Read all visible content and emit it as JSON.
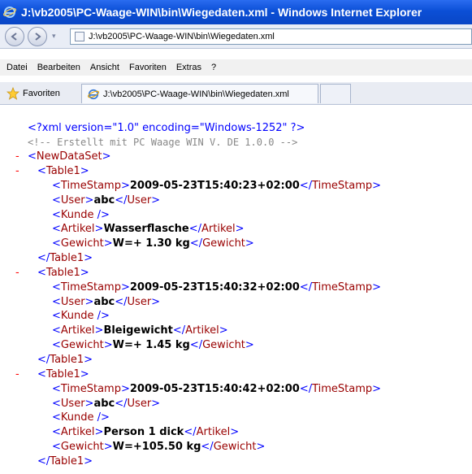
{
  "window": {
    "title": "J:\\vb2005\\PC-Waage-WIN\\bin\\Wiegedaten.xml - Windows Internet Explorer"
  },
  "address_bar": {
    "value": "J:\\vb2005\\PC-Waage-WIN\\bin\\Wiegedaten.xml"
  },
  "menu": [
    "Datei",
    "Bearbeiten",
    "Ansicht",
    "Favoriten",
    "Extras",
    "?"
  ],
  "favorites": {
    "label": "Favoriten",
    "tab_title": "J:\\vb2005\\PC-Waage-WIN\\bin\\Wiegedaten.xml"
  },
  "xml": {
    "declaration": "<?xml version=\"1.0\" encoding=\"Windows-1252\" ?>",
    "comment": "<!-- Erstellt mit PC Waage WIN V. DE 1.0.0  -->",
    "root": "NewDataSet",
    "record_tag": "Table1",
    "records": [
      {
        "TimeStamp": "2009-05-23T15:40:23+02:00",
        "User": "abc",
        "Artikel": "Wasserflasche",
        "Gewicht": "W=+ 1.30 kg"
      },
      {
        "TimeStamp": "2009-05-23T15:40:32+02:00",
        "User": "abc",
        "Artikel": "Bleigewicht",
        "Gewicht": "W=+ 1.45 kg"
      },
      {
        "TimeStamp": "2009-05-23T15:40:42+02:00",
        "User": "abc",
        "Artikel": "Person 1 dick",
        "Gewicht": "W=+105.50 kg"
      }
    ]
  },
  "colors": {
    "title_bar": "#0b4fd6",
    "tag": "#990000",
    "bracket": "#0000ff",
    "minus": "#ff0000",
    "comment": "#888888"
  }
}
